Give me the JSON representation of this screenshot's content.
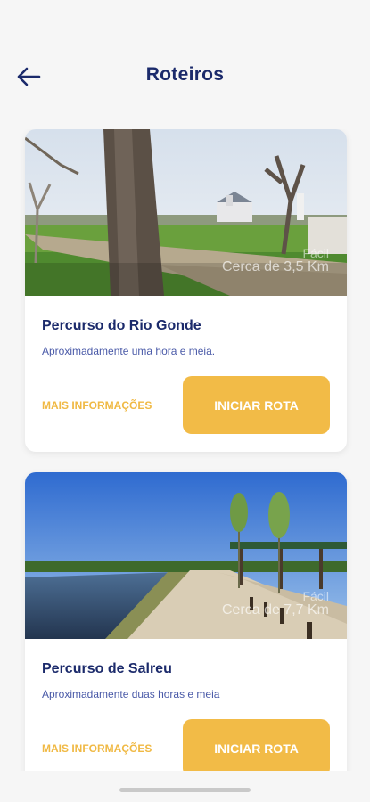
{
  "header": {
    "title": "Roteiros",
    "back_icon": "arrow-left-icon"
  },
  "colors": {
    "accent": "#f2bb47",
    "title": "#1b2a6b",
    "description": "#4a5aa8",
    "background": "#f6f6f6"
  },
  "routes": [
    {
      "overlay_text": "Fácil",
      "distance": "Cerca de 3,5 Km",
      "title": "Percurso do Rio Gonde",
      "description": "Aproximadamente uma hora e meia.",
      "more_info_label": "MAIS INFORMAÇÕES",
      "start_label": "INICIAR ROTA"
    },
    {
      "overlay_text": "Fácil",
      "distance": "Cerca de 7,7 Km",
      "title": "Percurso de Salreu",
      "description": "Aproximadamente duas horas e meia",
      "more_info_label": "MAIS INFORMAÇÕES",
      "start_label": "INICIAR ROTA"
    }
  ]
}
